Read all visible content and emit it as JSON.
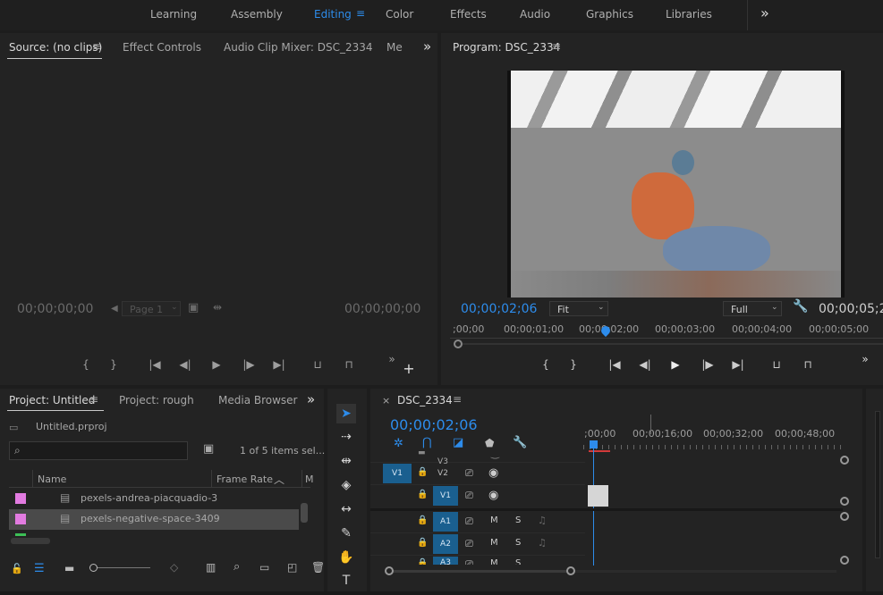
{
  "workspaces": {
    "tabs": [
      "Learning",
      "Assembly",
      "Editing",
      "Color",
      "Effects",
      "Audio",
      "Graphics",
      "Libraries"
    ],
    "active": "Editing",
    "more_glyph": "»"
  },
  "source_panel": {
    "tabs": [
      "Source: (no clips)",
      "Effect Controls",
      "Audio Clip Mixer: DSC_2334",
      "Me"
    ],
    "tc_in": "00;00;00;00",
    "tc_out": "00;00;00;00",
    "page_select": "Page 1",
    "more_glyph": "»"
  },
  "program_panel": {
    "title": "Program: DSC_2334",
    "playhead_tc": "00;00;02;06",
    "fit_select": "Fit",
    "quality_select": "Full",
    "duration_tc": "00;00;05;2",
    "ruler": [
      ";00;00",
      "00;00;01;00",
      "00;00;02;00",
      "00;00;03;00",
      "00;00;04;00",
      "00;00;05;00"
    ],
    "more_glyph": "»",
    "playhead_position": 0.36
  },
  "project_panel": {
    "tabs": [
      "Project: Untitled",
      "Project: rough",
      "Media Browser"
    ],
    "file": "Untitled.prproj",
    "search_placeholder": "",
    "items_count": "1 of 5 items sel...",
    "col_name": "Name",
    "col_frame_rate": "Frame Rate",
    "col_more": "M",
    "rows": [
      {
        "name": "pexels-andrea-piacquadio-3",
        "selected": false
      },
      {
        "name": "pexels-negative-space-3409",
        "selected": true
      }
    ],
    "more_glyph": "»",
    "label_color": "#e27be0"
  },
  "timeline_panel": {
    "sequence": "DSC_2334",
    "timecode": "00;00;02;06",
    "ruler": [
      ";00;00",
      "00;00;16;00",
      "00;00;32;00",
      "00;00;48;00"
    ],
    "tracks": {
      "video": [
        {
          "name": "V3",
          "source": ""
        },
        {
          "name": "V2",
          "source": "V1"
        },
        {
          "name": "V1",
          "source": ""
        }
      ],
      "audio": [
        {
          "name": "A1",
          "m": "M",
          "s": "S"
        },
        {
          "name": "A2",
          "m": "M",
          "s": "S"
        },
        {
          "name": "A3",
          "m": "M",
          "s": "S"
        }
      ]
    }
  },
  "colors": {
    "accent_blue": "#2d8ceb",
    "track_blue": "#1a5f8f",
    "panel_bg": "#232323",
    "selected_row": "#4a4a4a"
  },
  "icons": {
    "lock": "🔓",
    "eye": "👁",
    "camera": "▭",
    "mic": "🎤",
    "wrench": "🔧"
  }
}
